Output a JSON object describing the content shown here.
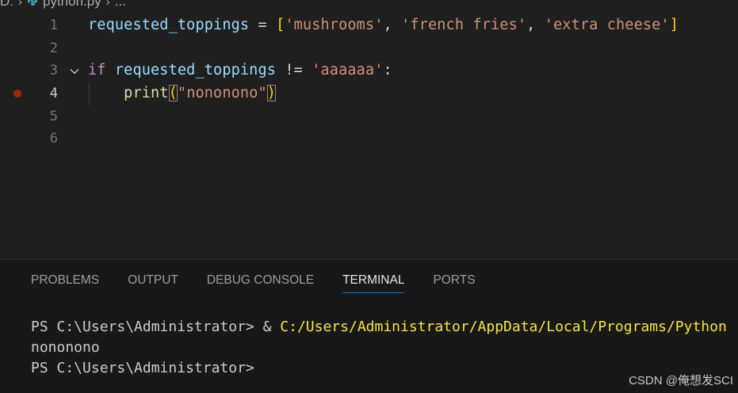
{
  "breadcrumb": {
    "drive": "D:",
    "file": "python.py",
    "more": "..."
  },
  "editor": {
    "lines": [
      {
        "num": "1"
      },
      {
        "num": "2"
      },
      {
        "num": "3"
      },
      {
        "num": "4"
      },
      {
        "num": "5"
      },
      {
        "num": "6"
      }
    ],
    "line1": {
      "var": "requested_toppings",
      "eq": " = ",
      "lbr": "[",
      "s1": "'mushrooms'",
      "c1": ", ",
      "s2": "'french fries'",
      "c2": ", ",
      "s3": "'extra cheese'",
      "rbr": "]"
    },
    "line3": {
      "kw": "if",
      "var": " requested_toppings",
      "op": " != ",
      "str": "'aaaaaa'",
      "colon": ":"
    },
    "line4": {
      "indent": "    ",
      "fn": "print",
      "lp": "(",
      "str": "\"nononono\"",
      "rp": ")"
    }
  },
  "panel": {
    "tabs": [
      "PROBLEMS",
      "OUTPUT",
      "DEBUG CONSOLE",
      "TERMINAL",
      "PORTS"
    ],
    "active_tab": "TERMINAL"
  },
  "terminal": {
    "line1_prompt": "PS C:\\Users\\Administrator> & ",
    "line1_path": "C:/Users/Administrator/AppData/Local/Programs/Python",
    "line2": "nononono",
    "line3": "PS C:\\Users\\Administrator>"
  },
  "watermark": "CSDN @俺想发SCI",
  "colors": {
    "accent": "#0078d4",
    "breakpoint": "#a1260d",
    "string": "#ce9178",
    "keyword": "#c586c0"
  },
  "icons": [
    "python-file-icon",
    "chevron-right-icon",
    "fold-chevron-down-icon",
    "breakpoint-icon"
  ]
}
